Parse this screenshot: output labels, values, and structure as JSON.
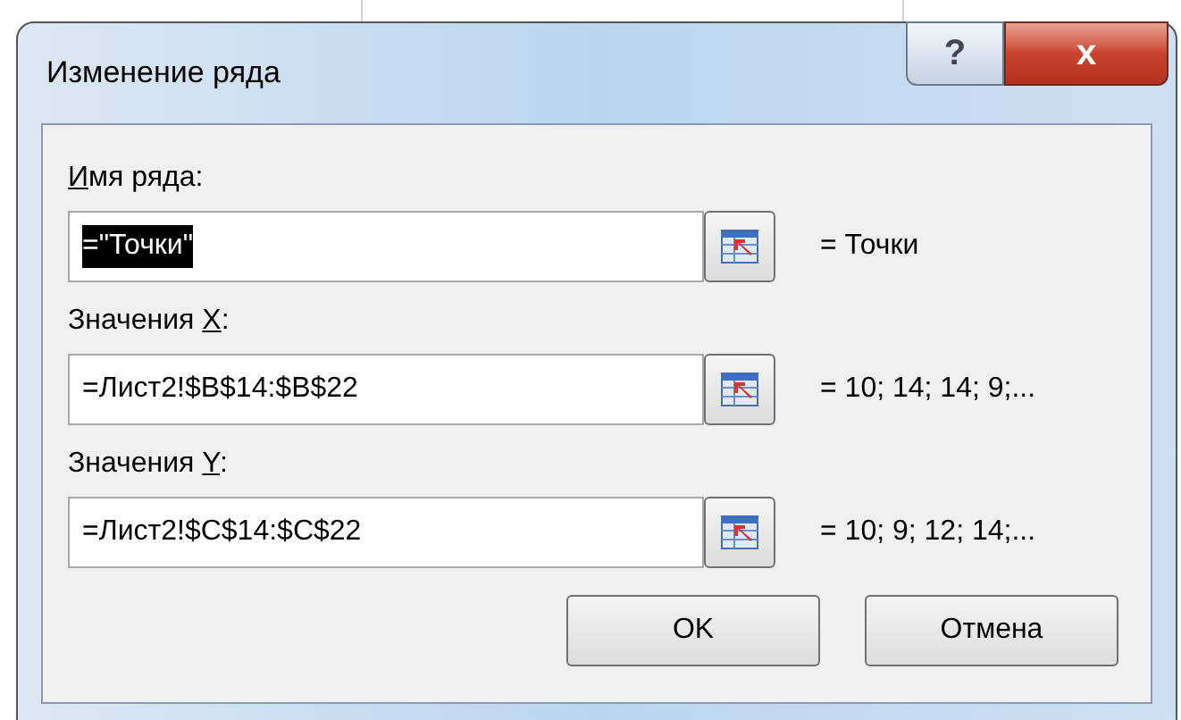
{
  "window": {
    "title": "Изменение ряда",
    "help_button": "?",
    "close_button": "x"
  },
  "fields": [
    {
      "label": {
        "access_key": "И",
        "after": "мя ряда:"
      },
      "value": "=\"Точки\"",
      "value_selected": true,
      "result": "= Точки"
    },
    {
      "label": {
        "before": "Значения ",
        "access_key": "X",
        "after": ":"
      },
      "value": "=Лист2!$B$14:$B$22",
      "value_selected": false,
      "result": "= 10; 14; 14; 9;..."
    },
    {
      "label": {
        "before": "Значения ",
        "access_key": "Y",
        "after": ":"
      },
      "value": "=Лист2!$C$14:$C$22",
      "value_selected": false,
      "result": "= 10; 9; 12; 14;..."
    }
  ],
  "buttons": [
    {
      "label": "OK"
    },
    {
      "label": "Отмена"
    }
  ]
}
